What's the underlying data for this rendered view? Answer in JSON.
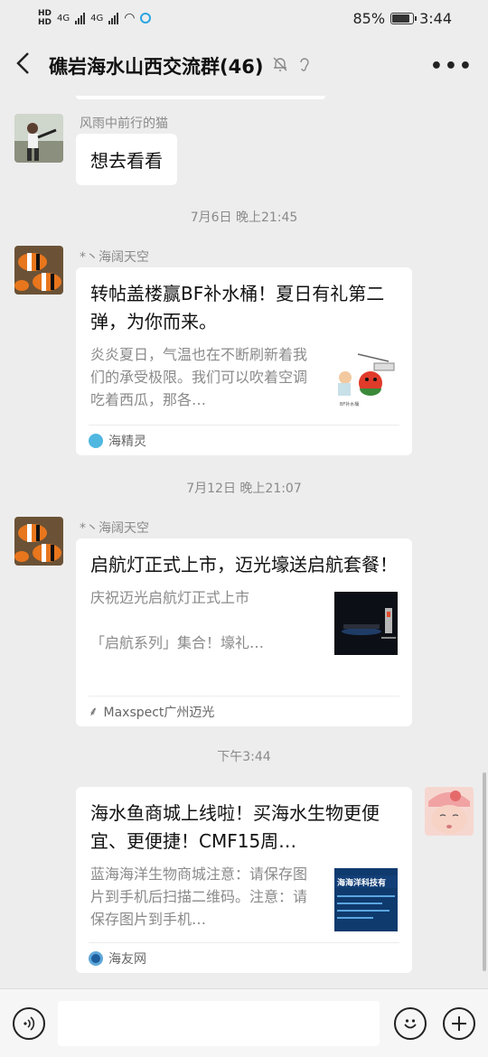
{
  "status": {
    "hd1": "HD",
    "hd2": "HD",
    "net1": "4G",
    "net2": "4G",
    "battery": "85%",
    "battery_level": 0.85,
    "time": "3:44"
  },
  "header": {
    "back_icon": "chevron-left-icon",
    "title": "礁岩海水山西交流群(46)",
    "more_icon": "ellipsis-icon"
  },
  "messages": [
    {
      "sender": "风雨中前行的猫",
      "text": "想去看看"
    },
    {
      "timestamp": "7月6日 晚上21:45"
    },
    {
      "sender": "*丶海阔天空",
      "card": {
        "title": "转帖盖楼赢BF补水桶！夏日有礼第二弹，为你而来。",
        "desc": "炎炎夏日，气温也在不断刷新着我们的承受极限。我们可以吹着空调吃着西瓜，那各…",
        "source": "海精灵"
      }
    },
    {
      "timestamp": "7月12日 晚上21:07"
    },
    {
      "sender": "*丶海阔天空",
      "card": {
        "title": "启航灯正式上市，迈光壕送启航套餐！",
        "desc": "庆祝迈光启航灯正式上市\n\n「启航系列」集合！壕礼…",
        "source": "Maxspect广州迈光"
      }
    },
    {
      "timestamp": "下午3:44"
    },
    {
      "self": true,
      "card": {
        "title": "海水鱼商城上线啦！买海水生物更便宜、更便捷！CMF15周…",
        "desc": "蓝海海洋生物商城注意：请保存图片到手机后扫描二维码。注意：请保存图片到手机…",
        "source": "海友网"
      }
    }
  ],
  "thumb_text": {
    "card1_label": "BF补水桶",
    "card3_label": "海海洋科技有"
  },
  "input": {
    "voice_icon": "voice-icon",
    "placeholder": "",
    "emoji_icon": "emoji-icon",
    "plus_icon": "plus-icon"
  },
  "colors": {
    "background": "#ededed",
    "bubble": "#ffffff",
    "meta_text": "#8a8a8a"
  }
}
